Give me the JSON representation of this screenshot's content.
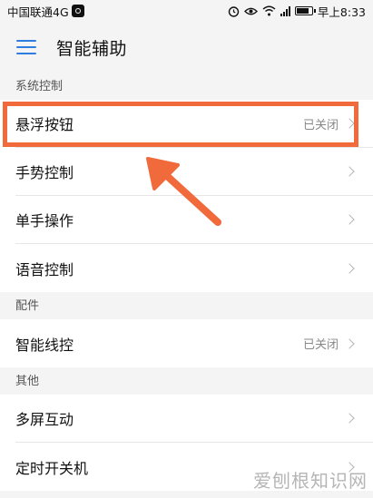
{
  "status_bar": {
    "carrier": "中国联通4G",
    "time": "早上8:33",
    "battery_level": 0.8
  },
  "app_bar": {
    "menu_icon": "hamburger-menu-icon",
    "title": "智能辅助"
  },
  "sections": [
    {
      "header": "系统控制",
      "items": [
        {
          "label": "悬浮按钮",
          "value": "已关闭"
        },
        {
          "label": "手势控制",
          "value": ""
        },
        {
          "label": "单手操作",
          "value": ""
        },
        {
          "label": "语音控制",
          "value": ""
        }
      ]
    },
    {
      "header": "配件",
      "items": [
        {
          "label": "智能线控",
          "value": "已关闭"
        }
      ]
    },
    {
      "header": "其他",
      "items": [
        {
          "label": "多屏互动",
          "value": ""
        },
        {
          "label": "定时开关机",
          "value": ""
        }
      ]
    }
  ],
  "annotation": {
    "color": "#f06a3c"
  },
  "watermark": "爱刨根知识网"
}
